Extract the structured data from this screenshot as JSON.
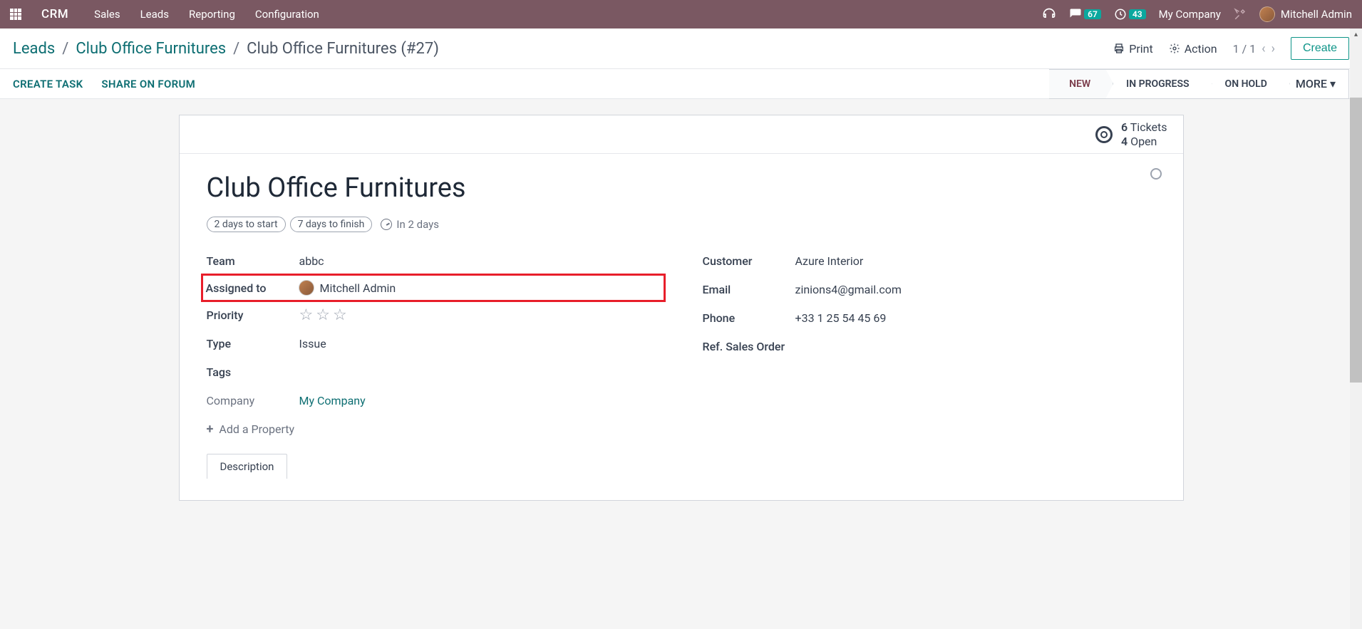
{
  "topbar": {
    "brand": "CRM",
    "nav": [
      "Sales",
      "Leads",
      "Reporting",
      "Configuration"
    ],
    "chat_badge": "67",
    "clock_badge": "43",
    "company": "My Company",
    "user": "Mitchell Admin"
  },
  "breadcrumb": {
    "root": "Leads",
    "mid": "Club Office Furnitures",
    "current": "Club Office Furnitures (#27)"
  },
  "header": {
    "print": "Print",
    "action": "Action",
    "pager": "1 / 1",
    "create": "Create"
  },
  "actions": {
    "create_task": "CREATE TASK",
    "share_forum": "SHARE ON FORUM"
  },
  "stages": {
    "new": "NEW",
    "in_progress": "IN PROGRESS",
    "on_hold": "ON HOLD",
    "more": "MORE"
  },
  "tickets": {
    "count": "6",
    "count_label": "Tickets",
    "open": "4",
    "open_label": "Open"
  },
  "record": {
    "title": "Club Office Furnitures",
    "chip_start": "2 days to start",
    "chip_finish": "7 days to finish",
    "due": "In 2 days"
  },
  "left": {
    "team_label": "Team",
    "team_value": "abbc",
    "assigned_label": "Assigned to",
    "assigned_value": "Mitchell Admin",
    "priority_label": "Priority",
    "type_label": "Type",
    "type_value": "Issue",
    "tags_label": "Tags",
    "company_label": "Company",
    "company_value": "My Company",
    "add_property": "Add a Property"
  },
  "right": {
    "customer_label": "Customer",
    "customer_value": "Azure Interior",
    "email_label": "Email",
    "email_value": "zinions4@gmail.com",
    "phone_label": "Phone",
    "phone_value": "+33 1 25 54 45 69",
    "ref_label": "Ref. Sales Order"
  },
  "tabs": {
    "description": "Description"
  }
}
